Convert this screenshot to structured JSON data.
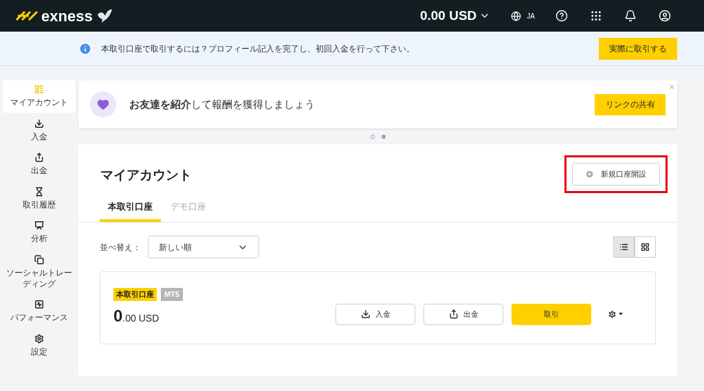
{
  "header": {
    "logo": "exness",
    "balance": "0.00 USD",
    "language": "JA"
  },
  "notice": {
    "text": "本取引口座で取引するには？プロフィール記入を完了し、初回入金を行って下さい。",
    "button": "実際に取引する"
  },
  "sidebar": {
    "items": [
      {
        "label": "マイアカウント",
        "selected": true
      },
      {
        "label": "入金",
        "selected": false
      },
      {
        "label": "出金",
        "selected": false
      },
      {
        "label": "取引履歴",
        "selected": false
      },
      {
        "label": "分析",
        "selected": false
      },
      {
        "label": "ソーシャルトレーディング",
        "selected": false
      },
      {
        "label": "パフォーマンス",
        "selected": false
      },
      {
        "label": "設定",
        "selected": false
      }
    ]
  },
  "promo": {
    "text": "**お友達を紹介**して報酬を獲得しましょう",
    "button": "リンクの共有",
    "close": "×",
    "dots": [
      {
        "selected": false
      },
      {
        "selected": true
      }
    ]
  },
  "accounts": {
    "title": "マイアカウント",
    "new_account_button": "新規口座開設",
    "tabs": [
      {
        "label": "本取引口座",
        "selected": true
      },
      {
        "label": "デモ口座",
        "selected": false
      }
    ],
    "sort_label": "並べ替え：",
    "sort_value": "新しい順",
    "views": [
      {
        "kind": "list",
        "selected": true
      },
      {
        "kind": "grid",
        "selected": false
      }
    ],
    "cards": [
      {
        "type_badge": "本取引口座",
        "platform_badge": "MT5",
        "balance_integer": "0",
        "balance_fraction": ".00 USD",
        "deposit": "入金",
        "withdraw": "出金",
        "trade": "取引"
      }
    ]
  }
}
